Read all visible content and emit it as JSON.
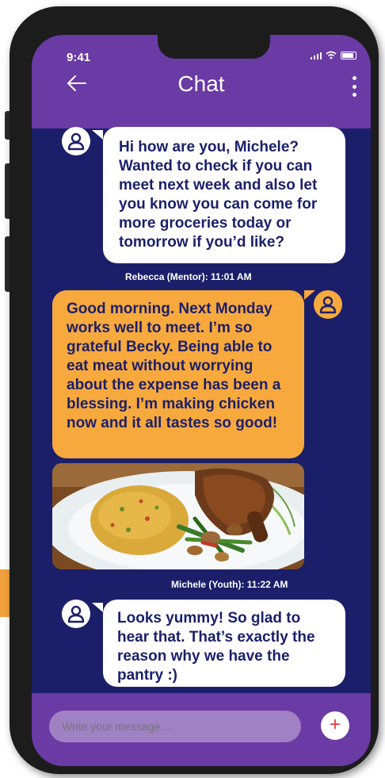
{
  "status": {
    "time": "9:41"
  },
  "header": {
    "title": "Chat"
  },
  "messages": [
    {
      "text": "Hi how are you, Michele? Wanted to check if you can meet next week and also let you know you can come for more groceries today or tomorrow if you’d like?",
      "meta": "Rebecca (Mentor): 11:01 AM"
    },
    {
      "text": "Good morning. Next Monday works well to meet. I’m so grateful Becky. Being able to eat meat without worrying about the expense has been a blessing. I’m making chicken now and it all tastes so good!",
      "meta": "Michele (Youth): 11:22 AM"
    },
    {
      "text": "Looks yummy! So glad to hear that. That’s exactly the reason why we have the pantry :)"
    }
  ],
  "composer": {
    "placeholder": "Write your message....",
    "send_label": "+"
  },
  "colors": {
    "header": "#6a3aa5",
    "background": "#1b1f6a",
    "accent": "#f7a93d",
    "send_icon": "#e23a3a"
  }
}
